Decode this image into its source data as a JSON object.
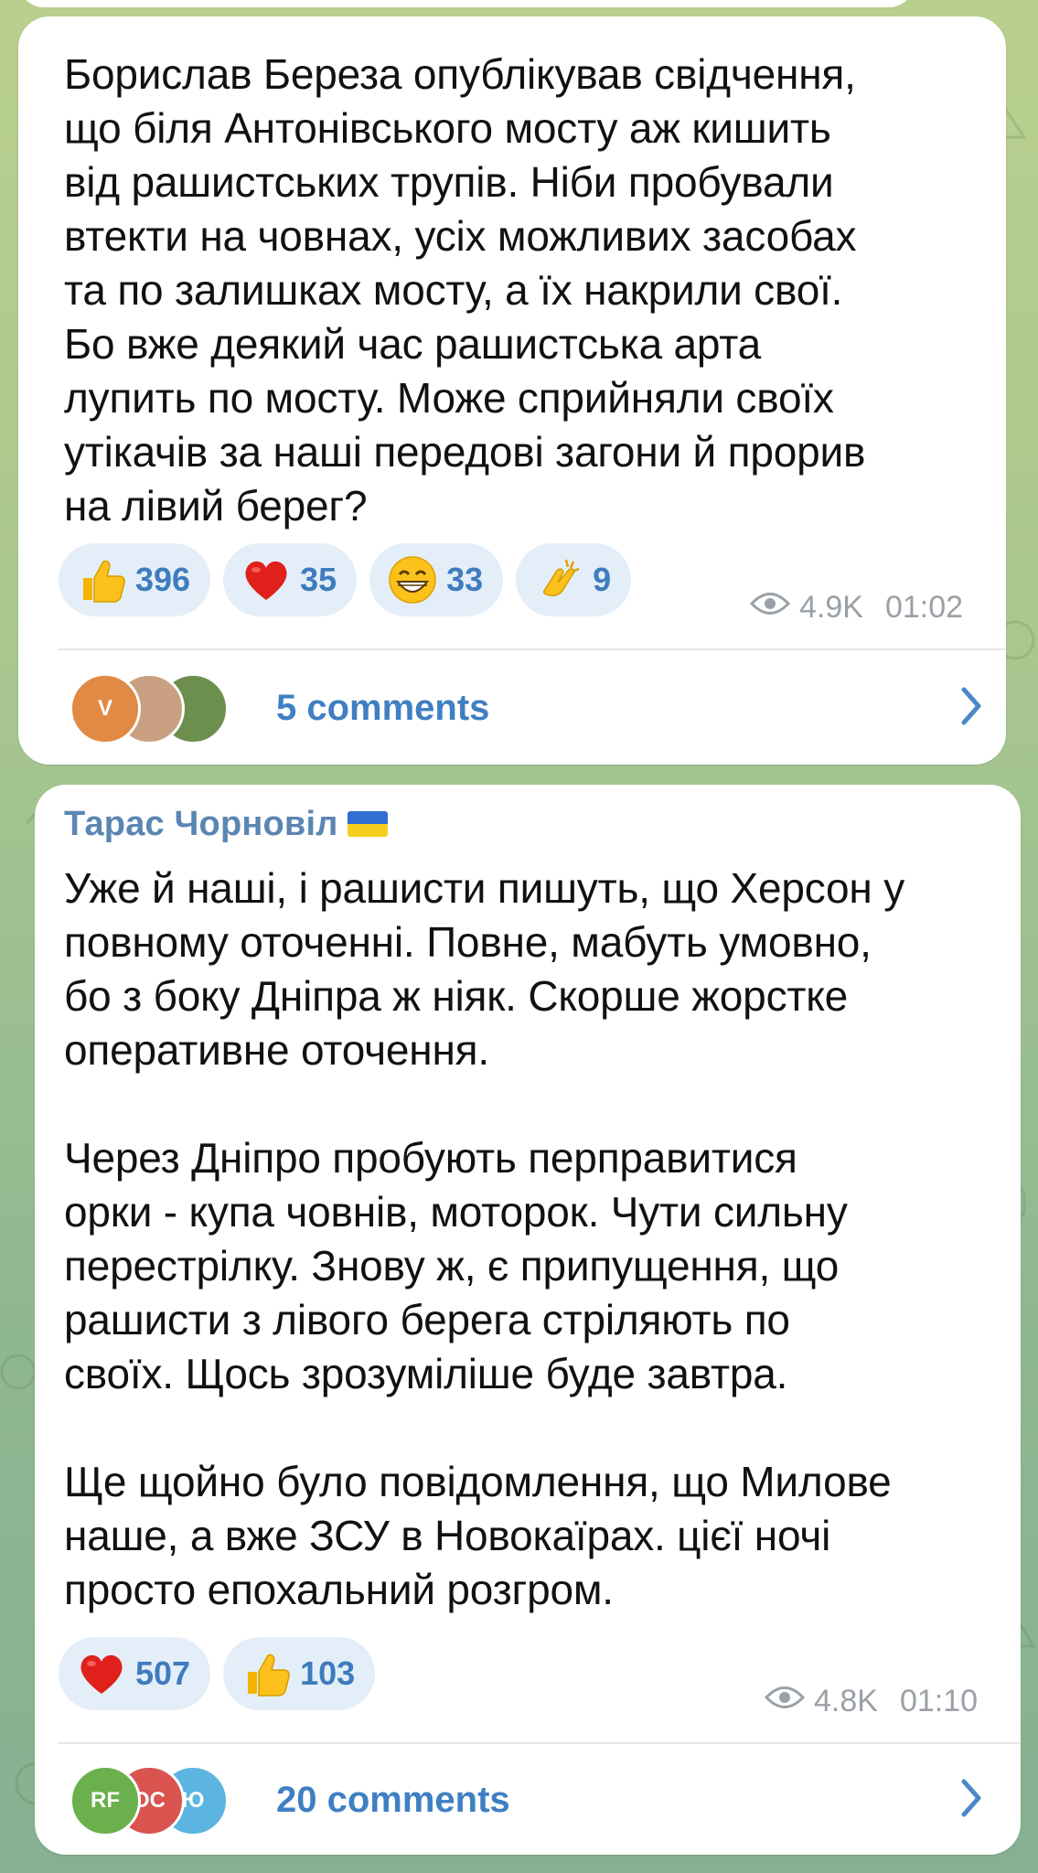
{
  "messages": [
    {
      "text": "Борислав Береза опублікував свідчення,\nщо біля Антонівського мосту аж кишить\nвід рашистських трупів. Ніби пробували\nвтекти на човнах, усіх можливих засобах\nта по залишках мосту, а їх накрили свої.\nБо вже деякий час рашистська арта\nлупить по мосту. Може сприйняли своїх\nутікачів за наші передові загони й прорив\nна лівий берег?",
      "reactions": [
        {
          "icon": "thumbs-up-icon",
          "count": "396"
        },
        {
          "icon": "heart-icon",
          "count": "35"
        },
        {
          "icon": "grin-face-icon",
          "count": "33"
        },
        {
          "icon": "clapping-hands-icon",
          "count": "9"
        }
      ],
      "views": "4.9K",
      "time": "01:02",
      "comments_label": "5 comments",
      "avatars": [
        {
          "label": "V",
          "color": "#e08a45"
        },
        {
          "label": "",
          "color": "#b88c6e"
        },
        {
          "label": "",
          "color": "#6d8f4e"
        }
      ]
    },
    {
      "author": "Тарас Чорновіл",
      "text": "Уже й наші, і рашисти пишуть, що Херсон у\nповному оточенні. Повне, мабуть умовно,\nбо з боку Дніпра ж ніяк. Скорше жорстке\nоперативне оточення.\n\nЧерез Дніпро пробують перправитися\nорки - купа човнів, моторок. Чути сильну\nперестрілку. Знову ж, є припущення, що\nрашисти з лівого берега стріляють по\nсвоїх. Щось зрозуміліше буде завтра.\n\nЩе щойно було повідомлення, що Милове\nнаше, а вже ЗСУ в Новокаїрах. цієї ночі\nпросто епохальний розгром.",
      "reactions": [
        {
          "icon": "heart-icon",
          "count": "507"
        },
        {
          "icon": "thumbs-up-icon",
          "count": "103"
        }
      ],
      "views": "4.8K",
      "time": "01:10",
      "comments_label": "20 comments",
      "avatars": [
        {
          "label": "RF",
          "color": "#6ab04c"
        },
        {
          "label": "OC",
          "color": "#d9534f"
        },
        {
          "label": "Ю",
          "color": "#5bb5e0"
        }
      ]
    }
  ]
}
